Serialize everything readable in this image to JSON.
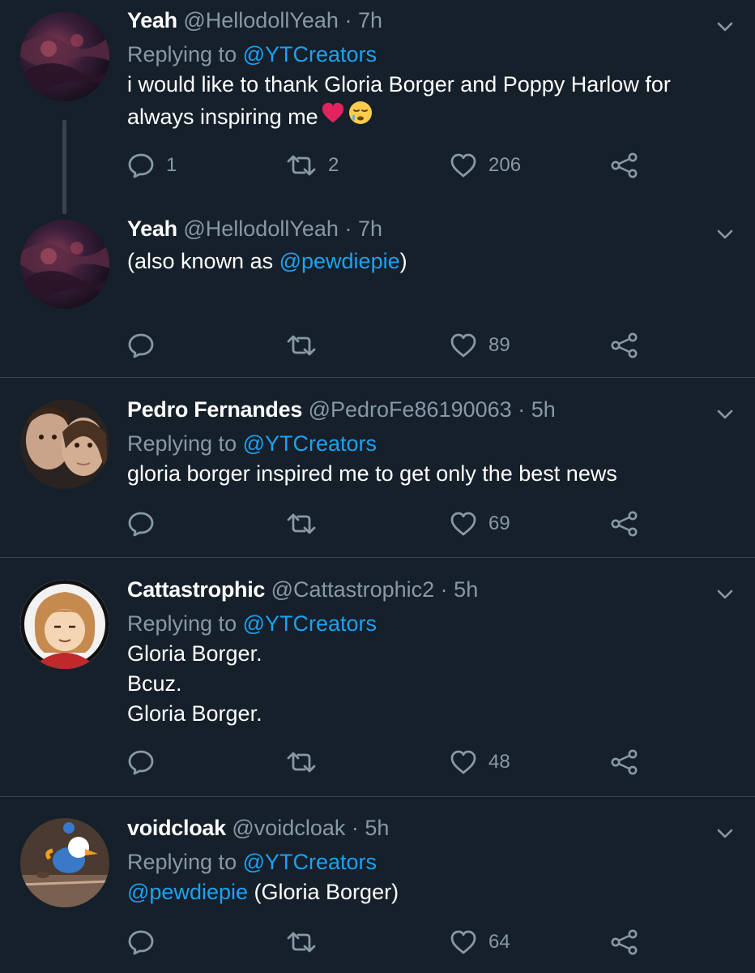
{
  "tweets": [
    {
      "name": "Yeah",
      "handle": "@HellodollYeah",
      "dot": "·",
      "time": "7h",
      "replying_prefix": "Replying to",
      "replying_to": "@YTCreators",
      "text_lines": [
        "i would like to thank Gloria Borger and Poppy Harlow for",
        "always inspiring me"
      ],
      "emoji": [
        "red heart",
        "sleepy face"
      ],
      "replies": "1",
      "retweets": "2",
      "likes": "206"
    },
    {
      "name": "Yeah",
      "handle": "@HellodollYeah",
      "dot": "·",
      "time": "7h",
      "text_prefix": "(also known as ",
      "text_link": "@pewdiepie",
      "text_suffix": ")",
      "likes": "89"
    },
    {
      "name": "Pedro Fernandes",
      "handle": "@PedroFe86190063",
      "dot": "·",
      "time": "5h",
      "replying_prefix": "Replying to",
      "replying_to": "@YTCreators",
      "text": "gloria borger inspired me to get only the best news",
      "likes": "69"
    },
    {
      "name": "Cattastrophic",
      "handle": "@Cattastrophic2",
      "dot": "·",
      "time": "5h",
      "replying_prefix": "Replying to",
      "replying_to": "@YTCreators",
      "text_lines": [
        "Gloria Borger.",
        "Bcuz.",
        "Gloria Borger."
      ],
      "likes": "48"
    },
    {
      "name": "voidcloak",
      "handle": "@voidcloak",
      "dot": "·",
      "time": "5h",
      "replying_prefix": "Replying to",
      "replying_to": "@YTCreators",
      "text_link": "@pewdiepie",
      "text_suffix": " (Gloria Borger)",
      "likes": "64"
    }
  ],
  "colors": {
    "background": "#15202b",
    "secondary_text": "#8899a6",
    "link": "#1da1f2",
    "divider": "#38444d"
  },
  "icons": [
    "reply-icon",
    "retweet-icon",
    "like-icon",
    "share-icon",
    "chevron-down-icon"
  ]
}
